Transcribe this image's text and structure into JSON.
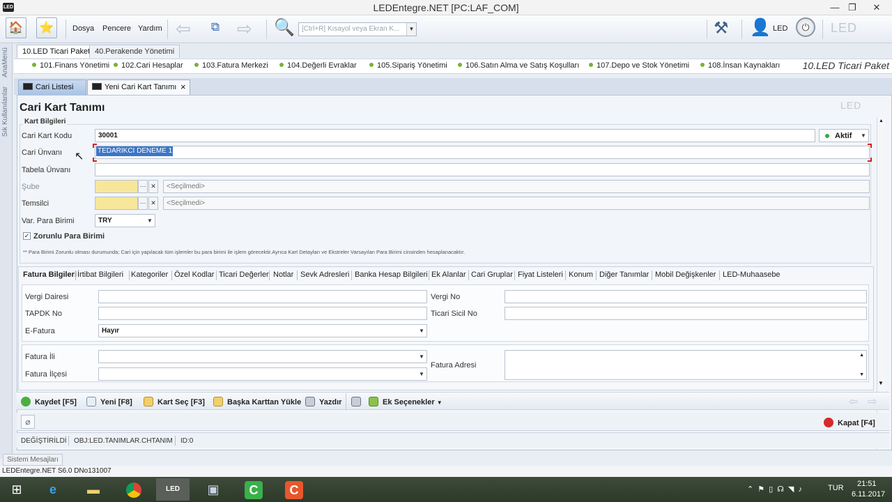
{
  "window": {
    "title": "LEDEntegre.NET [PC:LAF_COM]",
    "app_icon": "LED"
  },
  "toolbar": {
    "menus": [
      "Dosya",
      "Pencere",
      "Yardım"
    ],
    "search_placeholder": "[Ctrl+R] Kısayol veya Ekran K...",
    "user": "LED"
  },
  "side": {
    "tab1": "AnaMenü",
    "tab2": "Sık Kullanılanlar"
  },
  "packages": {
    "tabs": [
      "10.LED Ticari Paket",
      "40.Perakende Yönetimi"
    ],
    "current_label": "10.LED Ticari Paket"
  },
  "modules": [
    "101.Finans Yönetimi",
    "102.Cari Hesaplar",
    "103.Fatura Merkezi",
    "104.Değerli Evraklar",
    "105.Sipariş Yönetimi",
    "106.Satın Alma ve Satış Koşulları",
    "107.Depo ve Stok Yönetimi",
    "108.İnsan Kaynakları"
  ],
  "doc_tabs": {
    "tab1": "Cari Listesi",
    "tab2": "Yeni Cari Kart Tanımı",
    "close": "×"
  },
  "form": {
    "title": "Cari Kart Tanımı",
    "logo": "LED",
    "group_caption": "Kart Bilgileri",
    "kart_kodu_label": "Cari Kart Kodu",
    "kart_kodu_value": "30001",
    "status_value": "Aktif",
    "unvan_label": "Cari Ünvanı",
    "unvan_value": "TEDARIKCI DENEME 1",
    "tabela_label": "Tabela Ünvanı",
    "sube_label": "Şube",
    "sube_value": "<Seçilmedi>",
    "temsilci_label": "Temsilci",
    "temsilci_value": "<Seçilmedi>",
    "para_label": "Var. Para Birimi",
    "para_value": "TRY",
    "zorunlu_label": "Zorunlu Para Birimi",
    "note": "** Para Birimi Zorunlu olması durumunda; Cari için yapılacak tüm işlemler bu para birimi ile işlem görecektir.Ayrıca Kart Detayları ve Ekstreler Varsayılan Para Birimi cinsinden hesaplanacaktır."
  },
  "subtabs": [
    "Fatura Bilgileri",
    "İrtibat Bilgileri",
    "Kategoriler",
    "Özel Kodlar",
    "Ticari Değerler",
    "Notlar",
    "Sevk Adresleri",
    "Banka Hesap Bilgileri",
    "Ek Alanlar",
    "Cari Gruplar",
    "Fiyat Listeleri",
    "Konum",
    "Diğer Tanımlar",
    "Mobil Değişkenler",
    "LED-Muhaasebe"
  ],
  "fatura": {
    "vergi_dairesi": "Vergi Dairesi",
    "vergi_no": "Vergi No",
    "tapdk": "TAPDK No",
    "ticari_sicil": "Ticari Sicil No",
    "efatura": "E-Fatura",
    "efatura_value": "Hayır",
    "il": "Fatura İli",
    "ilce": "Fatura İlçesi",
    "adres": "Fatura Adresi"
  },
  "buttons": {
    "save": "Kaydet [F5]",
    "new": "Yeni [F8]",
    "select": "Kart Seç [F3]",
    "load": "Başka Karttan Yükle",
    "print": "Yazdır",
    "more": "Ek Seçenekler",
    "close": "Kapat [F4]"
  },
  "status": {
    "state": "DEĞİŞTİRİLDİ",
    "obj": "OBJ:LED.TANIMLAR.CHTANIM",
    "id": "ID:0"
  },
  "sysmsg": "Sistem Mesajları",
  "version": "LEDEntegre.NET S6.0 DNo131007",
  "tray": {
    "lang": "TUR",
    "time": "21:51",
    "date": "6.11.2017"
  }
}
